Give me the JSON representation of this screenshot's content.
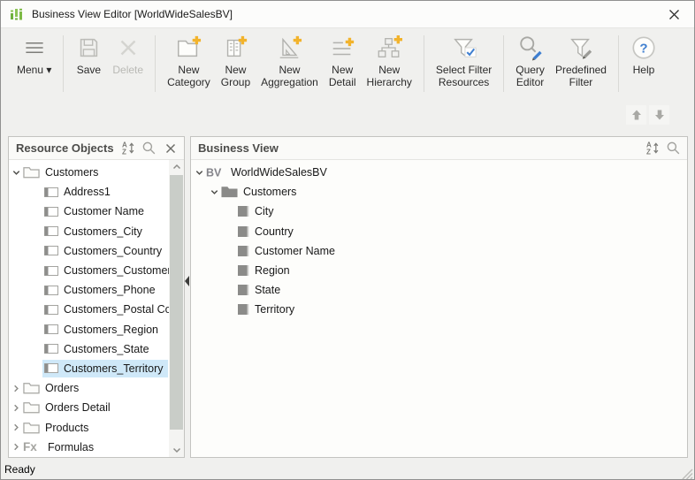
{
  "window": {
    "title": "Business View Editor [WorldWideSalesBV]",
    "status": "Ready"
  },
  "toolbar": {
    "items": [
      {
        "name": "menu",
        "label": "Menu ▾",
        "icon": "menu",
        "enabled": true
      },
      {
        "type": "sep"
      },
      {
        "name": "save",
        "label": "Save",
        "icon": "save",
        "enabled": true
      },
      {
        "name": "delete",
        "label": "Delete",
        "icon": "delete",
        "enabled": false
      },
      {
        "type": "sep"
      },
      {
        "name": "new-category",
        "label": "New\nCategory",
        "icon": "folder-plus",
        "enabled": true
      },
      {
        "name": "new-group",
        "label": "New\nGroup",
        "icon": "group-plus",
        "enabled": true
      },
      {
        "name": "new-aggregation",
        "label": "New\nAggregation",
        "icon": "aggregation-plus",
        "enabled": true
      },
      {
        "name": "new-detail",
        "label": "New\nDetail",
        "icon": "detail-plus",
        "enabled": true
      },
      {
        "name": "new-hierarchy",
        "label": "New\nHierarchy",
        "icon": "hierarchy-plus",
        "enabled": true
      },
      {
        "type": "sep"
      },
      {
        "name": "select-filter-resources",
        "label": "Select Filter\nResources",
        "icon": "funnel-check",
        "enabled": true
      },
      {
        "type": "sep"
      },
      {
        "name": "query-editor",
        "label": "Query\nEditor",
        "icon": "magnifier-pencil",
        "enabled": true
      },
      {
        "name": "predefined-filter",
        "label": "Predefined\nFilter",
        "icon": "funnel-pencil",
        "enabled": true
      },
      {
        "type": "sep"
      },
      {
        "name": "help",
        "label": "Help",
        "icon": "help",
        "enabled": true
      }
    ]
  },
  "panels": {
    "left": {
      "title": "Resource Objects",
      "tree": [
        {
          "label": "Customers",
          "icon": "folder",
          "chevron": "expanded",
          "level": 0
        },
        {
          "label": "Address1",
          "icon": "column",
          "chevron": "none",
          "level": 1
        },
        {
          "label": "Customer Name",
          "icon": "column",
          "chevron": "none",
          "level": 1
        },
        {
          "label": "Customers_City",
          "icon": "column",
          "chevron": "none",
          "level": 1
        },
        {
          "label": "Customers_Country",
          "icon": "column",
          "chevron": "none",
          "level": 1
        },
        {
          "label": "Customers_Customer ID",
          "icon": "column",
          "chevron": "none",
          "level": 1
        },
        {
          "label": "Customers_Phone",
          "icon": "column",
          "chevron": "none",
          "level": 1
        },
        {
          "label": "Customers_Postal Code",
          "icon": "column",
          "chevron": "none",
          "level": 1
        },
        {
          "label": "Customers_Region",
          "icon": "column",
          "chevron": "none",
          "level": 1
        },
        {
          "label": "Customers_State",
          "icon": "column",
          "chevron": "none",
          "level": 1
        },
        {
          "label": "Customers_Territory",
          "icon": "column",
          "chevron": "none",
          "level": 1,
          "selected": true
        },
        {
          "label": "Orders",
          "icon": "folder",
          "chevron": "collapsed",
          "level": 0
        },
        {
          "label": "Orders Detail",
          "icon": "folder",
          "chevron": "collapsed",
          "level": 0
        },
        {
          "label": "Products",
          "icon": "folder",
          "chevron": "collapsed",
          "level": 0
        },
        {
          "label": "Formulas",
          "icon": "fx",
          "chevron": "collapsed",
          "level": 0
        }
      ]
    },
    "right": {
      "title": "Business View",
      "tree": [
        {
          "label": "WorldWideSalesBV",
          "icon": "bv",
          "chevron": "expanded",
          "level": 0
        },
        {
          "label": "Customers",
          "icon": "folder-filled",
          "chevron": "expanded",
          "level": 1
        },
        {
          "label": "City",
          "icon": "field",
          "chevron": "none",
          "level": 2
        },
        {
          "label": "Country",
          "icon": "field",
          "chevron": "none",
          "level": 2
        },
        {
          "label": "Customer Name",
          "icon": "field",
          "chevron": "none",
          "level": 2
        },
        {
          "label": "Region",
          "icon": "field",
          "chevron": "none",
          "level": 2
        },
        {
          "label": "State",
          "icon": "field",
          "chevron": "none",
          "level": 2
        },
        {
          "label": "Territory",
          "icon": "field",
          "chevron": "none",
          "level": 2
        }
      ]
    }
  },
  "colors": {
    "accent_blue": "#3f7fd0",
    "plus_yellow": "#f2b32c",
    "logo_green": "#7cb944",
    "selection_blue": "#cfe8f8",
    "icon_gray": "#b2b2ae"
  }
}
